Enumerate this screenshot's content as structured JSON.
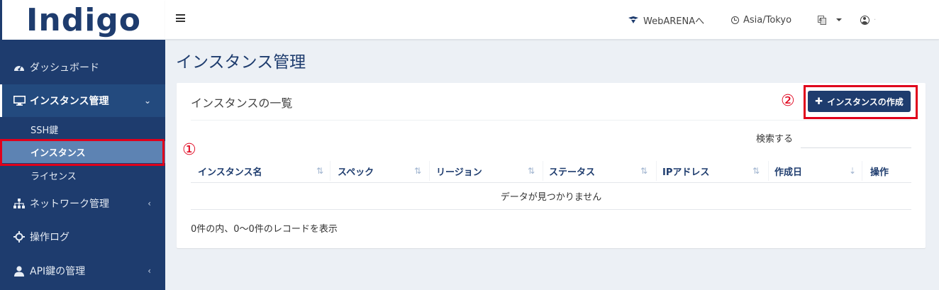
{
  "brand": {
    "logo_text": "Indigo",
    "color": "#1e3c6e"
  },
  "navbar": {
    "webarena_label": "WebARENAへ",
    "timezone_label": "Asia/Tokyo",
    "lang_icon": "language-icon",
    "user_icon": "user-circle-icon",
    "user_name": "·"
  },
  "sidebar": {
    "items": [
      {
        "label": "ダッシュボード",
        "icon": "dashboard-icon"
      },
      {
        "label": "インスタンス管理",
        "icon": "monitor-icon"
      },
      {
        "label": "ネットワーク管理",
        "icon": "sitemap-icon"
      },
      {
        "label": "操作ログ",
        "icon": "crosshair-icon"
      },
      {
        "label": "API鍵の管理",
        "icon": "user-icon"
      }
    ],
    "subitems": [
      {
        "label": "SSH鍵"
      },
      {
        "label": "インスタンス"
      },
      {
        "label": "ライセンス"
      }
    ]
  },
  "page": {
    "title": "インスタンス管理",
    "box_title": "インスタンスの一覧",
    "create_button": "インスタンスの作成",
    "search_label": "検索する",
    "search_value": "",
    "columns": [
      "インスタンス名",
      "スペック",
      "リージョン",
      "ステータス",
      "IPアドレス",
      "作成日",
      "操作"
    ],
    "empty_message": "データが見つかりません",
    "info_text": "0件の内、0〜0件のレコードを表示"
  },
  "annotations": {
    "marker_1": "①",
    "marker_2": "②",
    "highlight_color": "#e0001b"
  }
}
